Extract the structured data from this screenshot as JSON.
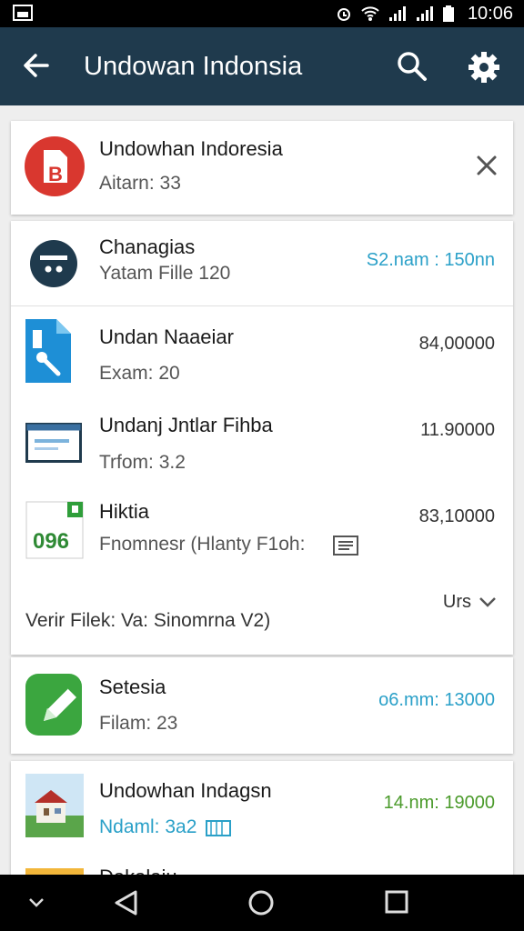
{
  "status_bar": {
    "time": "10:06"
  },
  "app_bar": {
    "title": "Undowan Indonsia"
  },
  "top_card": {
    "title": "Undowhan Indoresia",
    "subtitle": "Aitarn: 33"
  },
  "list_card": {
    "items": [
      {
        "title": "Chanagias",
        "subtitle": "Yatam Fille 120",
        "value": "S2.nam : 150nn",
        "value_color": "#2aa0c8"
      },
      {
        "title": "Undan Naaeiar",
        "subtitle": "Exam: 20",
        "value": "84,00000",
        "value_color": "#333333"
      },
      {
        "title": "Undanj Jntlar Fihba",
        "subtitle": "Trfom: 3.2",
        "value": "11.90000",
        "value_color": "#333333"
      },
      {
        "title": "Hiktia",
        "subtitle": "Fnomnesr (Hlanty F1oh:",
        "value": "83,10000",
        "value_color": "#333333"
      }
    ],
    "more_label": "Urs",
    "footer_text": "Verir Filek: Va: Sinomrna V2)"
  },
  "card3": {
    "title": "Setesia",
    "subtitle": "Filam: 23",
    "value": "o6.mm: 13000",
    "value_color": "#2aa0c8"
  },
  "card4": {
    "items": [
      {
        "title": "Undowhan Indagsn",
        "subtitle": "Ndaml: 3a2",
        "value": "14.nm: 19000",
        "value_color": "#4a9a2a",
        "subtitle_color": "#2aa0c8"
      },
      {
        "title": "Dakalaiu"
      }
    ]
  },
  "colors": {
    "appbar": "#1f3a4d",
    "accent_blue": "#2aa0c8",
    "accent_green": "#4a9a2a",
    "red_icon": "#d9372f"
  },
  "icons": [
    "back-arrow-icon",
    "search-icon",
    "gear-icon",
    "close-icon",
    "file-red-icon",
    "dialog-icon",
    "file-search-icon",
    "window-icon",
    "calendar-icon",
    "document-icon",
    "edit-icon",
    "house-photo-icon",
    "folder-icon",
    "chevron-down-icon",
    "nav-back-icon",
    "nav-home-icon",
    "nav-recents-icon"
  ]
}
